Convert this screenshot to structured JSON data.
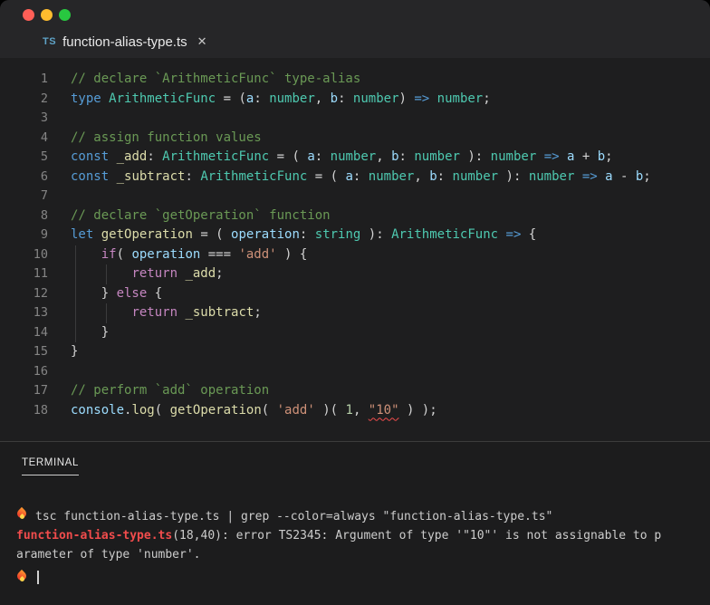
{
  "tab": {
    "icon": "TS",
    "filename": "function-alias-type.ts",
    "close": "✕"
  },
  "colors": {
    "comment": "#6a9955",
    "keyword": "#569cd6",
    "control": "#c586c0",
    "type": "#4ec9b0",
    "variable": "#9cdcfe",
    "function": "#dcdcaa",
    "string": "#ce9178",
    "number": "#b5cea8",
    "punctuation": "#d4d4d4",
    "line_number": "#858585",
    "error_squiggle": "#f14c4c",
    "terminal_fg": "#cccccc",
    "terminal_red": "#f14c4c",
    "editor_bg": "#1e1e1f",
    "chrome_bg": "#262628",
    "traffic_red": "#ff5f57",
    "traffic_yellow": "#febc2e",
    "traffic_green": "#28c840",
    "ts_icon_blue": "#5fa3c7"
  },
  "editor": {
    "lines": [
      {
        "n": "1",
        "segs": [
          [
            "c",
            "// declare `ArithmeticFunc` type-alias"
          ]
        ]
      },
      {
        "n": "2",
        "segs": [
          [
            "k",
            "type"
          ],
          [
            "p",
            " "
          ],
          [
            "t",
            "ArithmeticFunc"
          ],
          [
            "p",
            " = ("
          ],
          [
            "v",
            "a"
          ],
          [
            "p",
            ": "
          ],
          [
            "t",
            "number"
          ],
          [
            "p",
            ", "
          ],
          [
            "v",
            "b"
          ],
          [
            "p",
            ": "
          ],
          [
            "t",
            "number"
          ],
          [
            "p",
            ") "
          ],
          [
            "k",
            "=>"
          ],
          [
            "p",
            " "
          ],
          [
            "t",
            "number"
          ],
          [
            "p",
            ";"
          ]
        ]
      },
      {
        "n": "3",
        "segs": []
      },
      {
        "n": "4",
        "segs": [
          [
            "c",
            "// assign function values"
          ]
        ]
      },
      {
        "n": "5",
        "segs": [
          [
            "k",
            "const"
          ],
          [
            "p",
            " "
          ],
          [
            "f",
            "_add"
          ],
          [
            "p",
            ": "
          ],
          [
            "t",
            "ArithmeticFunc"
          ],
          [
            "p",
            " = ( "
          ],
          [
            "v",
            "a"
          ],
          [
            "p",
            ": "
          ],
          [
            "t",
            "number"
          ],
          [
            "p",
            ", "
          ],
          [
            "v",
            "b"
          ],
          [
            "p",
            ": "
          ],
          [
            "t",
            "number"
          ],
          [
            "p",
            " ): "
          ],
          [
            "t",
            "number"
          ],
          [
            "p",
            " "
          ],
          [
            "k",
            "=>"
          ],
          [
            "p",
            " "
          ],
          [
            "v",
            "a"
          ],
          [
            "p",
            " + "
          ],
          [
            "v",
            "b"
          ],
          [
            "p",
            ";"
          ]
        ]
      },
      {
        "n": "6",
        "segs": [
          [
            "k",
            "const"
          ],
          [
            "p",
            " "
          ],
          [
            "f",
            "_subtract"
          ],
          [
            "p",
            ": "
          ],
          [
            "t",
            "ArithmeticFunc"
          ],
          [
            "p",
            " = ( "
          ],
          [
            "v",
            "a"
          ],
          [
            "p",
            ": "
          ],
          [
            "t",
            "number"
          ],
          [
            "p",
            ", "
          ],
          [
            "v",
            "b"
          ],
          [
            "p",
            ": "
          ],
          [
            "t",
            "number"
          ],
          [
            "p",
            " ): "
          ],
          [
            "t",
            "number"
          ],
          [
            "p",
            " "
          ],
          [
            "k",
            "=>"
          ],
          [
            "p",
            " "
          ],
          [
            "v",
            "a"
          ],
          [
            "p",
            " - "
          ],
          [
            "v",
            "b"
          ],
          [
            "p",
            ";"
          ]
        ]
      },
      {
        "n": "7",
        "segs": []
      },
      {
        "n": "8",
        "segs": [
          [
            "c",
            "// declare `getOperation` function"
          ]
        ]
      },
      {
        "n": "9",
        "segs": [
          [
            "k",
            "let"
          ],
          [
            "p",
            " "
          ],
          [
            "f",
            "getOperation"
          ],
          [
            "p",
            " = ( "
          ],
          [
            "v",
            "operation"
          ],
          [
            "p",
            ": "
          ],
          [
            "t",
            "string"
          ],
          [
            "p",
            " ): "
          ],
          [
            "t",
            "ArithmeticFunc"
          ],
          [
            "p",
            " "
          ],
          [
            "k",
            "=>"
          ],
          [
            "p",
            " {"
          ]
        ]
      },
      {
        "n": "10",
        "g": [
          5
        ],
        "segs": [
          [
            "p",
            "    "
          ],
          [
            "ctl",
            "if"
          ],
          [
            "p",
            "( "
          ],
          [
            "v",
            "operation"
          ],
          [
            "p",
            " === "
          ],
          [
            "s",
            "'add'"
          ],
          [
            "p",
            " ) {"
          ]
        ]
      },
      {
        "n": "11",
        "g": [
          5,
          39
        ],
        "segs": [
          [
            "p",
            "        "
          ],
          [
            "ctl",
            "return"
          ],
          [
            "p",
            " "
          ],
          [
            "f",
            "_add"
          ],
          [
            "p",
            ";"
          ]
        ]
      },
      {
        "n": "12",
        "g": [
          5
        ],
        "segs": [
          [
            "p",
            "    } "
          ],
          [
            "ctl",
            "else"
          ],
          [
            "p",
            " {"
          ]
        ]
      },
      {
        "n": "13",
        "g": [
          5,
          39
        ],
        "segs": [
          [
            "p",
            "        "
          ],
          [
            "ctl",
            "return"
          ],
          [
            "p",
            " "
          ],
          [
            "f",
            "_subtract"
          ],
          [
            "p",
            ";"
          ]
        ]
      },
      {
        "n": "14",
        "g": [
          5
        ],
        "segs": [
          [
            "p",
            "    }"
          ]
        ]
      },
      {
        "n": "15",
        "segs": [
          [
            "p",
            "}"
          ]
        ]
      },
      {
        "n": "16",
        "segs": []
      },
      {
        "n": "17",
        "segs": [
          [
            "c",
            "// perform `add` operation"
          ]
        ]
      },
      {
        "n": "18",
        "segs": [
          [
            "v",
            "console"
          ],
          [
            "p",
            "."
          ],
          [
            "f",
            "log"
          ],
          [
            "p",
            "( "
          ],
          [
            "f",
            "getOperation"
          ],
          [
            "p",
            "( "
          ],
          [
            "s",
            "'add'"
          ],
          [
            "p",
            " )( "
          ],
          [
            "n",
            "1"
          ],
          [
            "p",
            ", "
          ],
          [
            "serr",
            "\"10\""
          ],
          [
            "p",
            " ) );"
          ]
        ]
      }
    ]
  },
  "terminal": {
    "label": "TERMINAL",
    "lines": [
      {
        "prompt": true,
        "segs": [
          [
            "fg",
            "tsc function-alias-type.ts | grep --color=always \"function-alias-type.ts\""
          ]
        ]
      },
      {
        "segs": [
          [
            "red",
            "function-alias-type.ts"
          ],
          [
            "fg",
            "(18,40): error TS2345: Argument of type '\"10\"' is not assignable to p"
          ]
        ]
      },
      {
        "segs": [
          [
            "fg",
            "arameter of type 'number'."
          ]
        ]
      },
      {
        "prompt": true,
        "cursor": true,
        "segs": []
      }
    ]
  }
}
